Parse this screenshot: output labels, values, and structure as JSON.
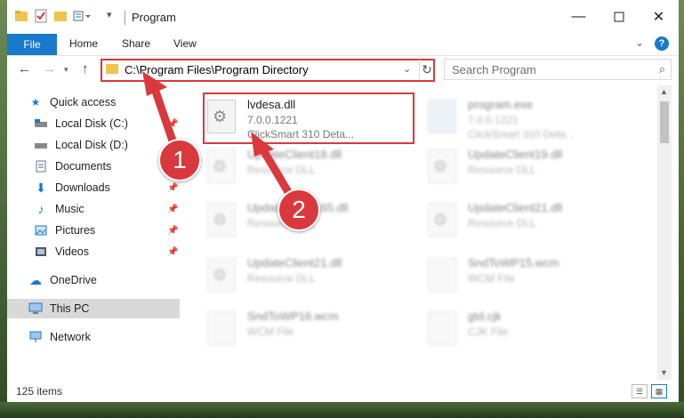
{
  "window": {
    "title": "Program",
    "controls": [
      "minimize-icon",
      "maximize-icon",
      "close-icon"
    ]
  },
  "ribbon": {
    "tabs": [
      {
        "label": "File",
        "active": true
      },
      {
        "label": "Home"
      },
      {
        "label": "Share"
      },
      {
        "label": "View"
      }
    ]
  },
  "address": {
    "path": "C:\\Program Files\\Program Directory",
    "search_placeholder": "Search Program"
  },
  "nav": {
    "items": [
      {
        "label": "Quick access",
        "icon": "star-icon",
        "level": 1
      },
      {
        "label": "Local Disk (C:)",
        "icon": "drive-icon",
        "pinned": true
      },
      {
        "label": "Local Disk (D:)",
        "icon": "drive-icon"
      },
      {
        "label": "Documents",
        "icon": "documents-icon",
        "pinned": true
      },
      {
        "label": "Downloads",
        "icon": "downloads-icon",
        "pinned": true
      },
      {
        "label": "Music",
        "icon": "music-icon",
        "pinned": true
      },
      {
        "label": "Pictures",
        "icon": "pictures-icon",
        "pinned": true
      },
      {
        "label": "Videos",
        "icon": "videos-icon",
        "pinned": true
      },
      {
        "label": "OneDrive",
        "icon": "cloud-icon",
        "level": 1
      },
      {
        "label": "This PC",
        "icon": "computer-icon",
        "level": 1,
        "selected": true
      },
      {
        "label": "Network",
        "icon": "network-icon",
        "level": 1
      }
    ]
  },
  "files": [
    {
      "name": "lvdesa.dll",
      "line2": "7.0.0.1221",
      "line3": "ClickSmart 310 Deta...",
      "highlighted": true
    },
    {
      "name": "program.exe",
      "line2": "7.0.0.1221",
      "line3": "ClickSmart 310 Deta..."
    },
    {
      "name": "UpdateClient18.dll",
      "line2": "Resource DLL"
    },
    {
      "name": "UpdateClient19.dll",
      "line2": "Resource DLL"
    },
    {
      "name": "UpdateClient165.dll",
      "line2": "Resource DLL"
    },
    {
      "name": "UpdateClient21.dll",
      "line2": "Resource DLL"
    },
    {
      "name": "UpdateClient21.dll",
      "line2": "Resource DLL"
    },
    {
      "name": "SndToWP15.wcm",
      "line2": "WCM File"
    },
    {
      "name": "SndToWP16.wcm",
      "line2": "WCM File"
    },
    {
      "name": "gtd.cjk",
      "line2": "CJK File"
    }
  ],
  "status": {
    "count": "125 items"
  },
  "annotations": [
    "1",
    "2"
  ],
  "colors": {
    "accent": "#1979ca",
    "highlight": "#d9393c",
    "folder": "#f0c24f"
  }
}
